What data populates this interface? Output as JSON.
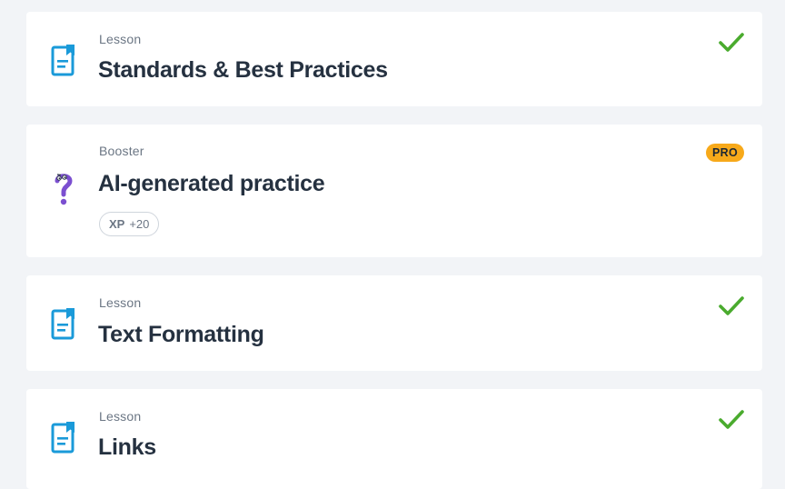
{
  "items": [
    {
      "kind": "Lesson",
      "title": "Standards & Best Practices",
      "icon": "lesson-icon",
      "status": "completed"
    },
    {
      "kind": "Booster",
      "title": "AI-generated practice",
      "icon": "question-mark-icon",
      "badge": "PRO",
      "xp_label": "XP",
      "xp_value": "+20"
    },
    {
      "kind": "Lesson",
      "title": "Text Formatting",
      "icon": "lesson-icon",
      "status": "completed"
    },
    {
      "kind": "Lesson",
      "title": "Links",
      "icon": "lesson-icon",
      "status": "completed"
    }
  ],
  "colors": {
    "lesson_icon": "#1a9ad9",
    "check": "#4aab2e",
    "pro_badge": "#f7a91a",
    "booster_icon": "#7b4fd0"
  }
}
